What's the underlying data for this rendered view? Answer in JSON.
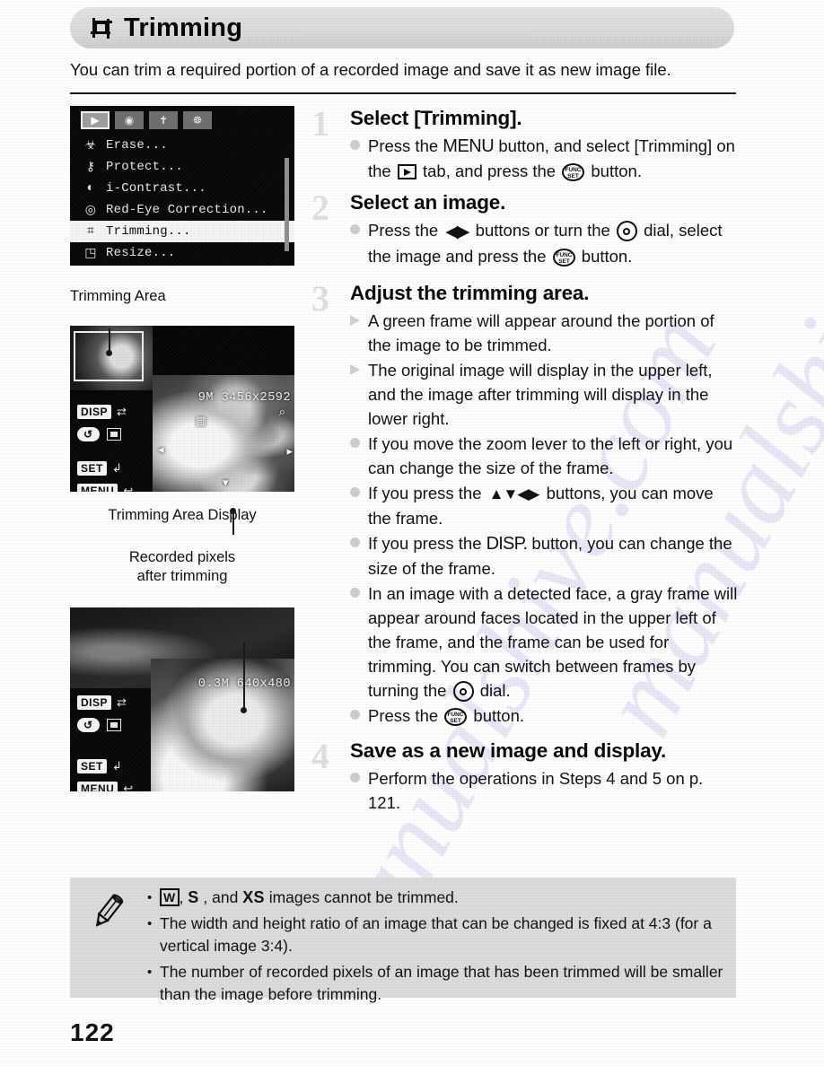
{
  "header": {
    "icon": "trimming-crop-icon",
    "title": "Trimming",
    "intro": "You can trim a required portion of a recorded image and save it as new image file."
  },
  "camera_menu_screen": {
    "tabs": [
      {
        "name": "playback-tab",
        "glyph": "▶",
        "selected": true
      },
      {
        "name": "shooting-tab",
        "glyph": "⊙",
        "selected": false
      },
      {
        "name": "settings-tab",
        "glyph": "ὒ7",
        "selected": false
      },
      {
        "name": "print-tab",
        "glyph": "⎈",
        "selected": false
      }
    ],
    "items": [
      {
        "icon": "erase-icon",
        "glyph": "Ὕ1",
        "label": "Erase...",
        "selected": false
      },
      {
        "icon": "protect-key-icon",
        "glyph": "⚷",
        "label": "Protect...",
        "selected": false
      },
      {
        "icon": "i-contrast-icon",
        "glyph": "◐",
        "label": "i-Contrast...",
        "selected": false
      },
      {
        "icon": "red-eye-correction-icon",
        "glyph": "◎",
        "label": "Red-Eye Correction...",
        "selected": false
      },
      {
        "icon": "trimming-icon",
        "glyph": "⌗",
        "label": "Trimming...",
        "selected": true
      },
      {
        "icon": "resize-icon",
        "glyph": "◳",
        "label": "Resize...",
        "selected": false
      }
    ]
  },
  "figure1": {
    "caption_top": "Trimming Area",
    "caption_bottom": "Trimming Area Display",
    "resolution_label": "9M 3456x2592",
    "hints": [
      {
        "key": "DISP",
        "glyph": "⇄"
      },
      {
        "key": "SET",
        "glyph": "↲"
      },
      {
        "key": "MENU",
        "glyph": "↩"
      }
    ],
    "zoom_glyph": "Q"
  },
  "figure2": {
    "caption_top_line1": "Recorded pixels",
    "caption_top_line2": "after trimming",
    "resolution_label": "0.3M 640x480",
    "hints": [
      {
        "key": "DISP",
        "glyph": "⇄"
      },
      {
        "key": "SET",
        "glyph": "↲"
      },
      {
        "key": "MENU",
        "glyph": "↩"
      }
    ]
  },
  "steps": [
    {
      "number": "1",
      "heading": "Select [Trimming].",
      "bullets": [
        {
          "style": "dot",
          "parts": [
            {
              "t": "text",
              "v": "Press the "
            },
            {
              "t": "glyph",
              "v": "MENU",
              "name": "menu-button-glyph"
            },
            {
              "t": "text",
              "v": " button, and select [Trimming] on the "
            },
            {
              "t": "glyph",
              "v": "playback",
              "name": "playback-button-glyph"
            },
            {
              "t": "text",
              "v": " tab, and press the "
            },
            {
              "t": "glyph",
              "v": "FUNC SET",
              "name": "func-set-button-glyph"
            },
            {
              "t": "text",
              "v": " button."
            }
          ]
        }
      ]
    },
    {
      "number": "2",
      "heading": "Select an image.",
      "bullets": [
        {
          "style": "dot",
          "parts": [
            {
              "t": "text",
              "v": "Press the "
            },
            {
              "t": "glyph",
              "v": "◀▶",
              "name": "left-right-buttons-glyph"
            },
            {
              "t": "text",
              "v": " buttons or turn the "
            },
            {
              "t": "glyph",
              "v": "dial",
              "name": "control-dial-glyph"
            },
            {
              "t": "text",
              "v": " dial, select the image and press the "
            },
            {
              "t": "glyph",
              "v": "FUNC SET",
              "name": "func-set-button-glyph"
            },
            {
              "t": "text",
              "v": " button."
            }
          ]
        }
      ]
    },
    {
      "number": "3",
      "heading": "Adjust the trimming area.",
      "bullets": [
        {
          "style": "arrow",
          "text": "A green frame will appear around the portion of the image to be trimmed."
        },
        {
          "style": "arrow",
          "text": "The original image will display in the upper left, and the image after trimming will display in the lower right."
        },
        {
          "style": "dot",
          "text": "If you move the zoom lever to the left or right, you can change the size of the frame."
        },
        {
          "style": "dot",
          "parts": [
            {
              "t": "text",
              "v": "If you press the "
            },
            {
              "t": "glyph",
              "v": "▲▼◀▶",
              "name": "four-way-buttons-glyph"
            },
            {
              "t": "text",
              "v": " buttons, you can move the frame."
            }
          ]
        },
        {
          "style": "dot",
          "parts": [
            {
              "t": "text",
              "v": "If you press the "
            },
            {
              "t": "glyph",
              "v": "DISP.",
              "name": "disp-button-glyph"
            },
            {
              "t": "text",
              "v": " button, you can change the size of the frame."
            }
          ]
        },
        {
          "style": "dot",
          "parts": [
            {
              "t": "text",
              "v": "In an image with a detected face, a gray frame will appear around faces located in the upper left of the frame, and the frame can be used for trimming. You can switch between frames by turning the "
            },
            {
              "t": "glyph",
              "v": "dial",
              "name": "control-dial-glyph"
            },
            {
              "t": "text",
              "v": " dial."
            }
          ]
        },
        {
          "style": "dot",
          "parts": [
            {
              "t": "text",
              "v": "Press the "
            },
            {
              "t": "glyph",
              "v": "FUNC SET",
              "name": "func-set-button-glyph"
            },
            {
              "t": "text",
              "v": " button."
            }
          ]
        }
      ]
    },
    {
      "number": "4",
      "heading": "Save as a new image and display.",
      "bullets": [
        {
          "style": "dot",
          "text": "Perform the operations in Steps 4 and 5 on p. 121."
        }
      ]
    }
  ],
  "notes": {
    "icon": "pencil-note-icon",
    "items": [
      {
        "parts": [
          {
            "t": "size",
            "v": "W",
            "boxed": true
          },
          {
            "t": "text",
            "v": ", "
          },
          {
            "t": "size",
            "v": "S",
            "boxed": false
          },
          {
            "t": "text",
            "v": " , and "
          },
          {
            "t": "size",
            "v": "XS",
            "boxed": false
          },
          {
            "t": "text",
            "v": " images cannot be trimmed."
          }
        ]
      },
      {
        "text": "The width and height ratio of an image that can be changed is fixed at 4:3 (for a vertical image 3:4)."
      },
      {
        "text": "The number of recorded pixels of an image that has been trimmed will be smaller than the image before trimming."
      }
    ]
  },
  "page_number": "122",
  "watermark": {
    "line1": "manualshive.com",
    "line2": "manualshive.com"
  },
  "colors": {
    "header_bar": "#dcdcdc",
    "notes_bg": "#dcdcdc",
    "text": "#111111",
    "step_number": "#c9c9c9",
    "watermark": "#5a5ac8"
  }
}
